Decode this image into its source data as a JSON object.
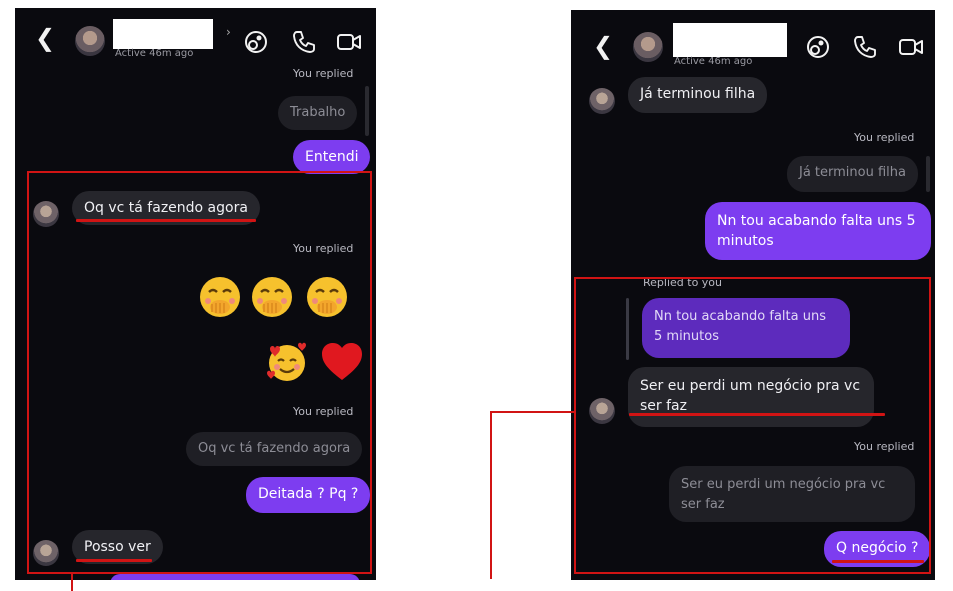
{
  "left": {
    "header": {
      "status": "Active 46m ago"
    },
    "messages": {
      "you_replied_1": "You replied",
      "quote_1": "Trabalho",
      "out_1": "Entendi",
      "in_1": "Oq vc tá fazendo agora",
      "you_replied_2": "You replied",
      "emoji_row_1": [
        "face-with-hand-over-mouth",
        "face-with-hand-over-mouth",
        "face-with-hand-over-mouth"
      ],
      "emoji_row_2": [
        "smiling-face-with-hearts",
        "red-heart"
      ],
      "you_replied_3": "You replied",
      "quote_2": "Oq vc tá fazendo agora",
      "out_2": "Deitada ? Pq ?",
      "in_2": "Posso ver"
    }
  },
  "right": {
    "header": {
      "status": "Active 46m ago"
    },
    "messages": {
      "in_1": "Já terminou filha",
      "you_replied_1": "You replied",
      "quote_1": "Já terminou filha",
      "out_1": "Nn tou acabando falta uns 5 minutos",
      "replied_to_you": "Replied to you",
      "quote_2": "Nn tou acabando falta uns 5 minutos",
      "in_2": "Ser eu perdi um negócio pra vc ser faz",
      "you_replied_2": "You replied",
      "quote_3": "Ser eu perdi um negócio pra vc ser faz",
      "out_2": "Q negócio ?"
    }
  },
  "colors": {
    "background": "#0a0a0f",
    "incoming_bubble": "#26262c",
    "outgoing_bubble": "#7d3df0",
    "highlight": "#d11414"
  }
}
